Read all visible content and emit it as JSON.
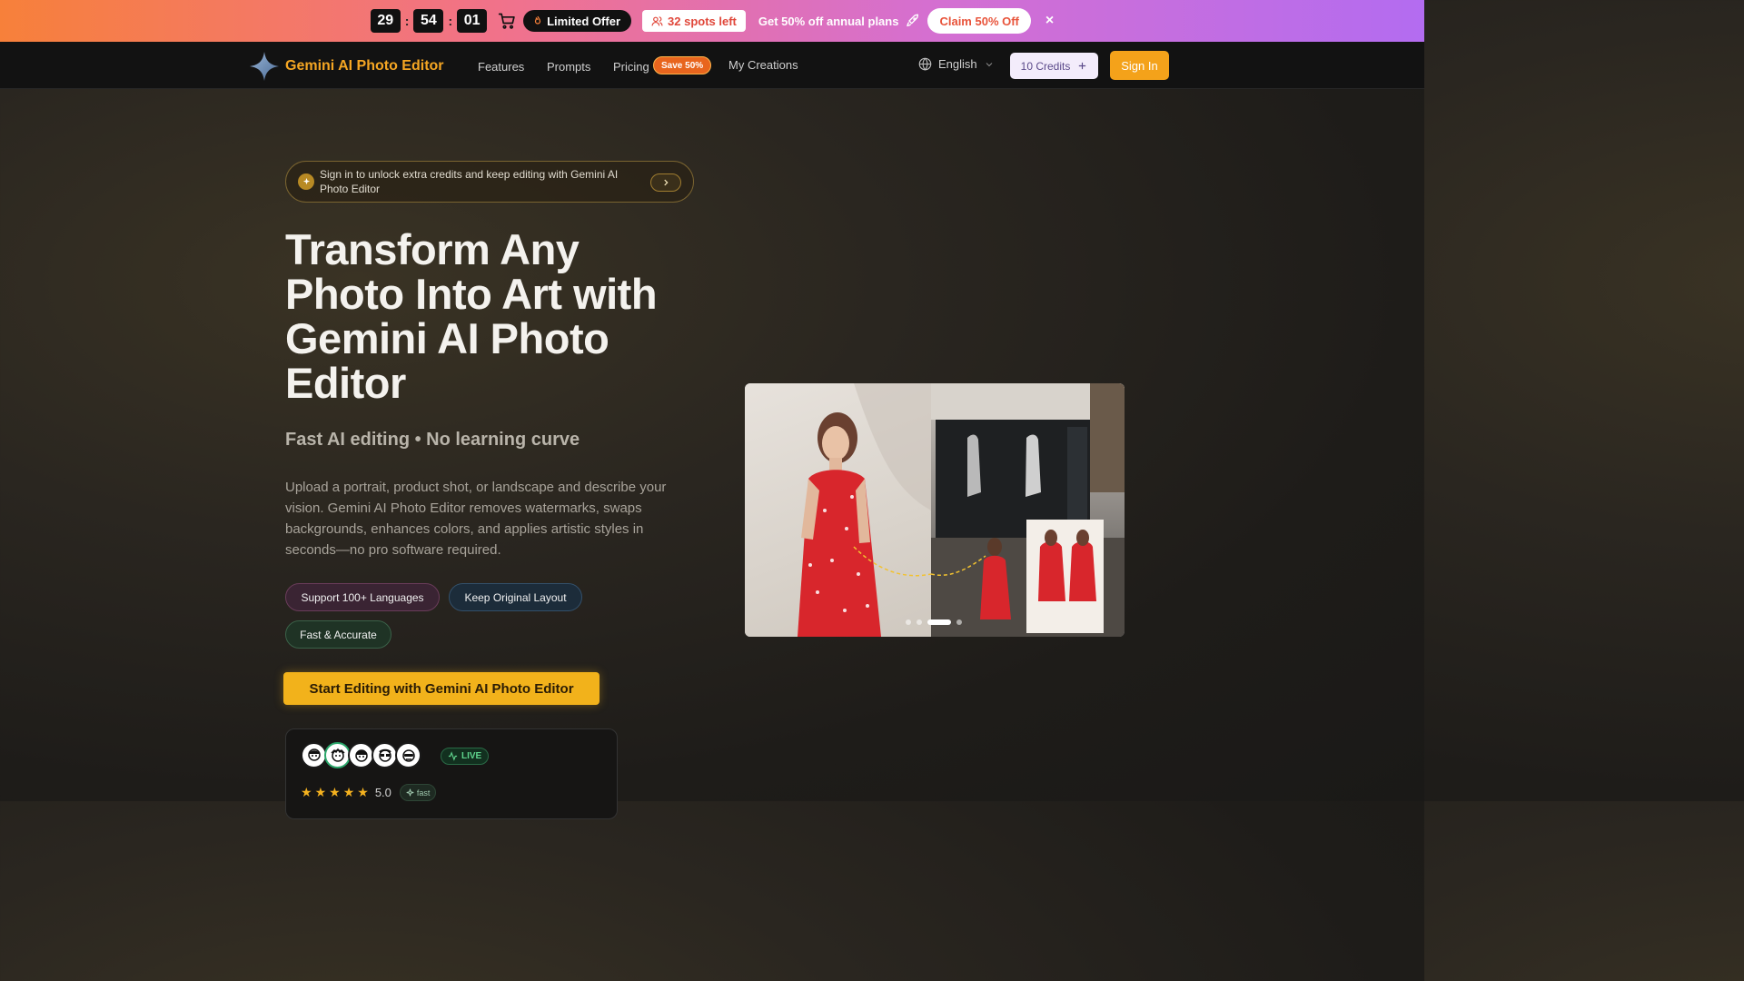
{
  "promo": {
    "timer": [
      "29",
      "54",
      "01"
    ],
    "limited_offer": "Limited Offer",
    "spots": "32 spots left",
    "text": "Get 50% off annual plans",
    "claim": "Claim 50% Off",
    "close": "×"
  },
  "nav": {
    "brand": "Gemini AI Photo Editor",
    "links": [
      "Features",
      "Prompts",
      "Pricing",
      "My Creations"
    ],
    "save_badge": "Save 50%",
    "language": "English",
    "credits": "10 Credits",
    "sign_in": "Sign In"
  },
  "hero": {
    "notice": "Sign in to unlock extra credits and keep editing with Gemini AI Photo Editor",
    "title": "Transform Any Photo Into Art with Gemini AI Photo Editor",
    "subhead": "Fast AI editing • No learning curve",
    "description": "Upload a portrait, product shot, or landscape and describe your vision. Gemini AI Photo Editor removes watermarks, swaps backgrounds, enhances colors, and applies artistic styles in seconds—no pro software required.",
    "tags": [
      "Support 100+ Languages",
      "Keep Original Layout",
      "Fast & Accurate"
    ],
    "cta": "Start Editing with Gemini AI Photo Editor"
  },
  "stats": {
    "live": "LIVE",
    "rating": "5.0",
    "stars": 5,
    "fast": "fast"
  },
  "carousel": {
    "slides": 4,
    "active_slide": 3
  },
  "colors": {
    "accent": "#f4a21a",
    "brand_text": "#f5a623",
    "promo_gradient_start": "#f7803a",
    "promo_gradient_end": "#b36cf0"
  }
}
